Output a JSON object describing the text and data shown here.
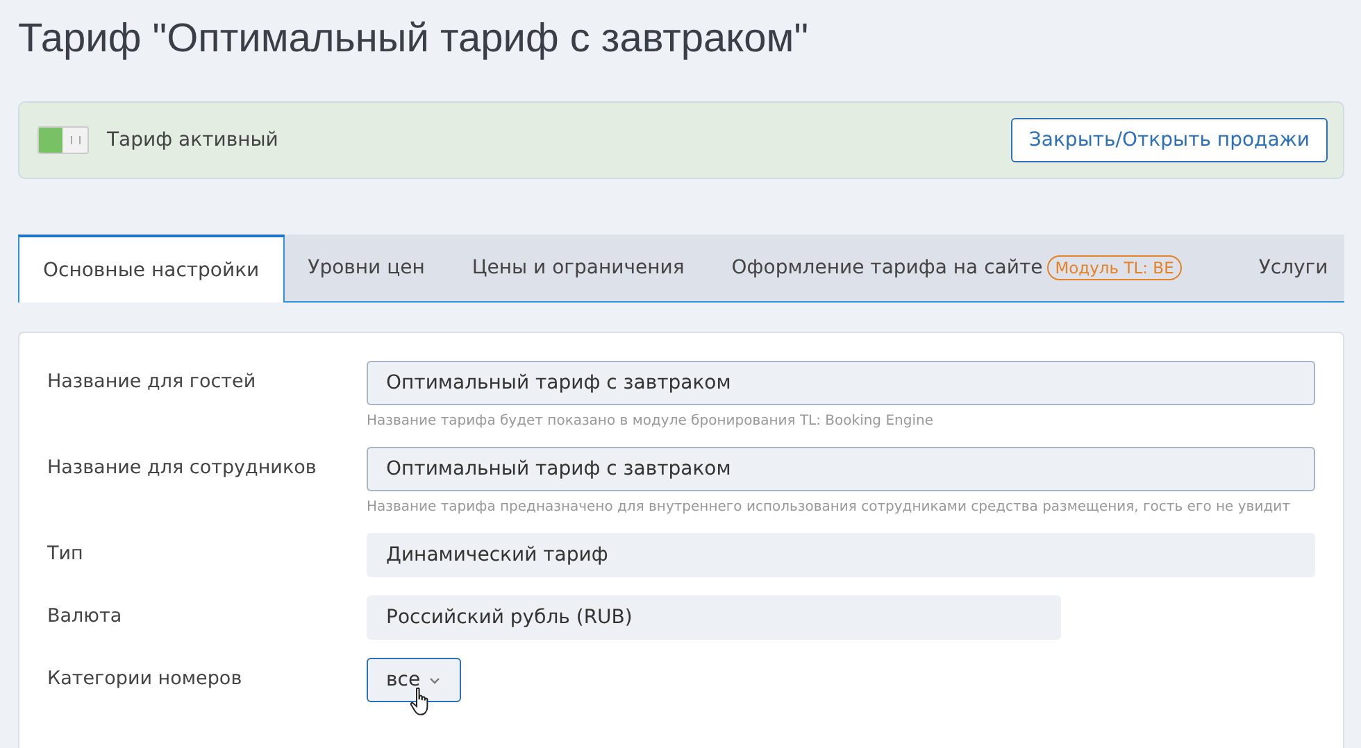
{
  "title": "Тариф \"Оптимальный тариф с завтраком\"",
  "status_banner": {
    "toggle_on": true,
    "label": "Тариф активный",
    "button": "Закрыть/Открыть продажи"
  },
  "tabs": [
    {
      "label": "Основные настройки",
      "selected": true
    },
    {
      "label": "Уровни цен",
      "selected": false
    },
    {
      "label": "Цены и ограничения",
      "selected": false
    },
    {
      "label": "Оформление тарифа на сайте",
      "badge": "Модуль TL: BE",
      "selected": false
    },
    {
      "label": "Услуги",
      "selected": false
    }
  ],
  "fields": [
    {
      "kind": "input",
      "label": "Название для гостей",
      "value": "Оптимальный тариф с завтраком",
      "hint": "Название тарифа будет показано в модуле бронирования TL: Booking Engine"
    },
    {
      "kind": "input",
      "label": "Название для сотрудников",
      "value": "Оптимальный тариф с завтраком",
      "hint": "Название тарифа предназначено для внутреннего использования сотрудниками средства размещения, гость его не увидит"
    },
    {
      "kind": "readonly",
      "label": "Тип",
      "value": "Динамический тариф"
    },
    {
      "kind": "readonly_short",
      "label": "Валюта",
      "value": "Российский рубль (RUB)"
    },
    {
      "kind": "dropdown",
      "label": "Категории номеров",
      "value": "все"
    }
  ]
}
